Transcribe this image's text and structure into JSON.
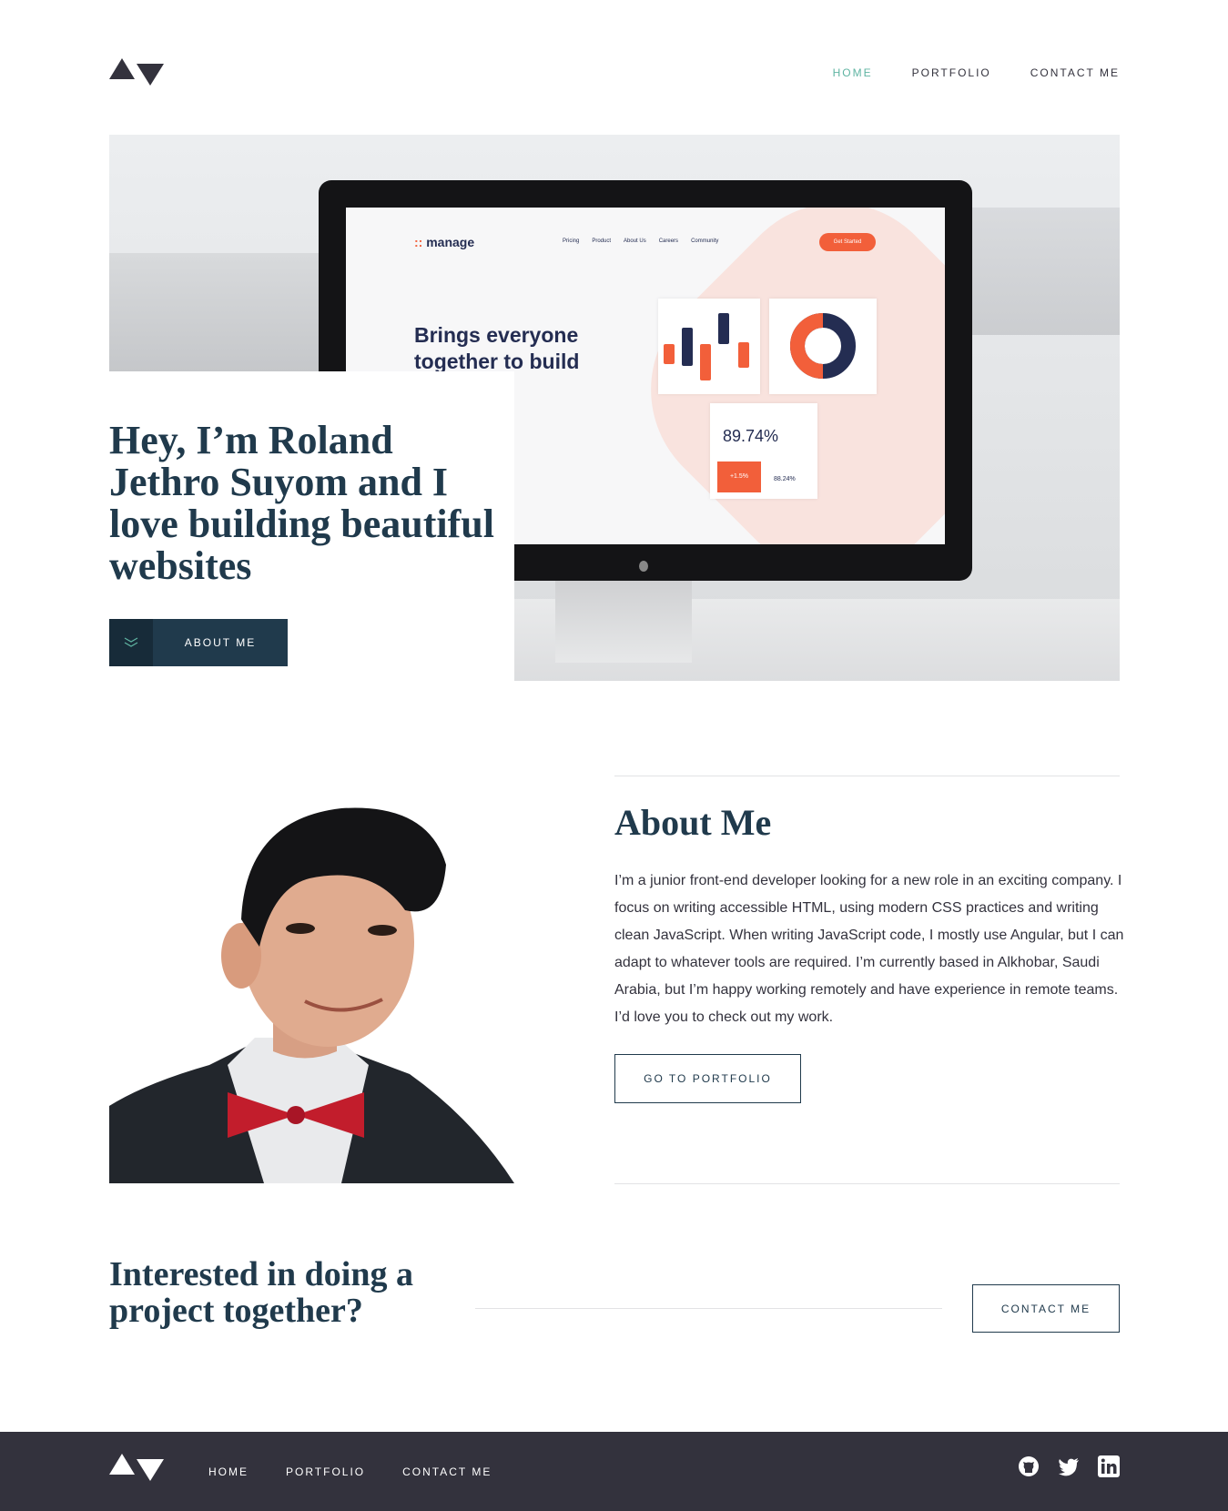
{
  "header": {
    "nav": [
      "HOME",
      "PORTFOLIO",
      "CONTACT ME"
    ],
    "active_color": "#5fb4a2"
  },
  "hero": {
    "title": "Hey, I’m Roland Jethro Suyom and I love building beautiful websites",
    "button_label": "ABOUT ME",
    "screen": {
      "brand": "manage",
      "nav": [
        "Pricing",
        "Product",
        "About Us",
        "Careers",
        "Community"
      ],
      "cta": "Get Started",
      "headline": "Brings everyone together to build products.",
      "percent": "89.74%",
      "box_value": "+1.5%",
      "small_value": "88.24%"
    }
  },
  "about": {
    "title": "About Me",
    "body": "I’m a junior front-end developer looking for a new role in an exciting company. I focus on writing accessible HTML, using modern CSS practices and writing clean JavaScript. When writing JavaScript code, I mostly use Angular, but I can adapt to whatever tools are required. I’m currently based in Alkhobar, Saudi Arabia, but I’m happy working remotely and have experience in remote teams. I’d love you to check out my work.",
    "button_label": "GO TO PORTFOLIO"
  },
  "cta": {
    "title": "Interested in doing a project together?",
    "button_label": "CONTACT ME"
  },
  "footer": {
    "nav": [
      "HOME",
      "PORTFOLIO",
      "CONTACT ME"
    ],
    "social_icons": [
      "github-icon",
      "twitter-icon",
      "linkedin-icon"
    ]
  },
  "colors": {
    "primary": "#203a4c",
    "dark": "#33323d",
    "accent": "#5fb4a2",
    "screen_accent": "#f25f3a",
    "screen_navy": "#242d52"
  }
}
